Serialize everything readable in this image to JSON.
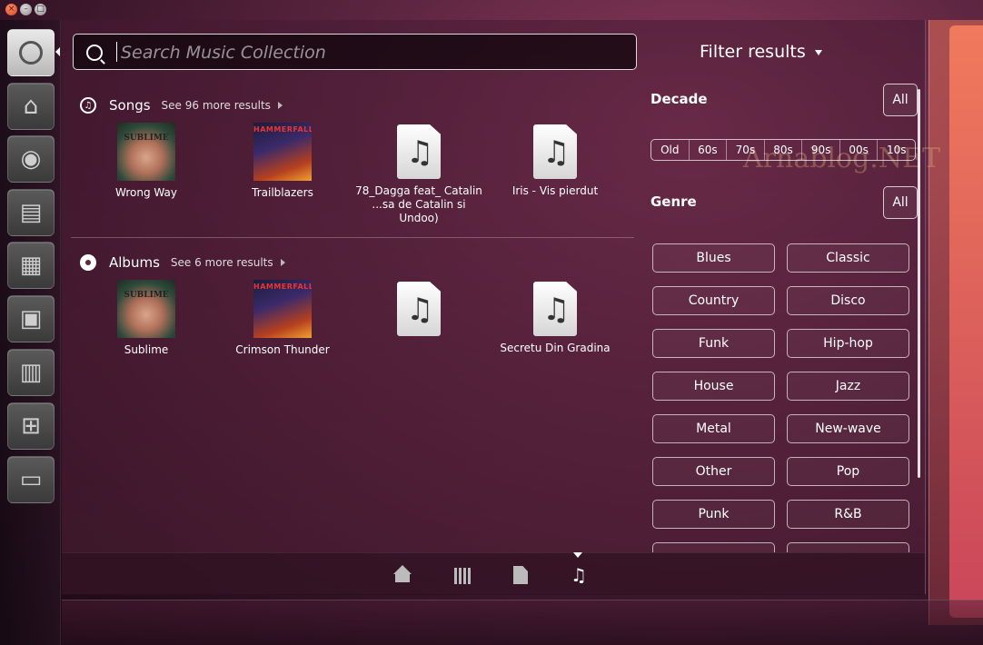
{
  "window": {
    "controls": [
      "close",
      "minimize",
      "maximize"
    ]
  },
  "launcher": {
    "items": [
      {
        "name": "ubuntu-logo-icon",
        "active": true
      },
      {
        "name": "home-folder-icon"
      },
      {
        "name": "firefox-icon"
      },
      {
        "name": "writer-icon"
      },
      {
        "name": "calc-icon"
      },
      {
        "name": "impress-icon"
      },
      {
        "name": "software-center-icon"
      },
      {
        "name": "workspaces-icon"
      },
      {
        "name": "trash-icon"
      }
    ]
  },
  "search": {
    "placeholder": "Search Music Collection",
    "value": ""
  },
  "songs": {
    "title": "Songs",
    "more": "See 96 more results",
    "items": [
      {
        "label": "Wrong Way",
        "cover": "sublime"
      },
      {
        "label": "Trailblazers",
        "cover": "hammerfall"
      },
      {
        "label_line1": "78_Dagga feat_ Catalin",
        "label_line2": "...sa de Catalin si Undoo)",
        "cover": "generic"
      },
      {
        "label": "Iris - Vis pierdut",
        "cover": "generic"
      }
    ]
  },
  "albums": {
    "title": "Albums",
    "more": "See 6 more results",
    "items": [
      {
        "label": "Sublime",
        "cover": "sublime"
      },
      {
        "label": "Crimson Thunder",
        "cover": "hammerfall"
      },
      {
        "label": "",
        "cover": "generic"
      },
      {
        "label": "Secretu Din Gradina",
        "cover": "generic"
      }
    ]
  },
  "covers": {
    "sublime_text": "SUBLIME",
    "hammer_text": "HAMMERFALL"
  },
  "filter": {
    "title": "Filter results",
    "decade": {
      "label": "Decade",
      "all": "All",
      "options": [
        "Old",
        "60s",
        "70s",
        "80s",
        "90s",
        "00s",
        "10s"
      ]
    },
    "genre": {
      "label": "Genre",
      "all": "All",
      "options": [
        "Blues",
        "Classic",
        "Country",
        "Disco",
        "Funk",
        "Hip-hop",
        "House",
        "Jazz",
        "Metal",
        "New-wave",
        "Other",
        "Pop",
        "Punk",
        "R&B",
        "",
        ""
      ]
    }
  },
  "watermark": "Arnablog.NET",
  "lenses": [
    {
      "name": "home-lens-icon"
    },
    {
      "name": "applications-lens-icon"
    },
    {
      "name": "files-lens-icon"
    },
    {
      "name": "music-lens-icon",
      "active": true
    }
  ]
}
